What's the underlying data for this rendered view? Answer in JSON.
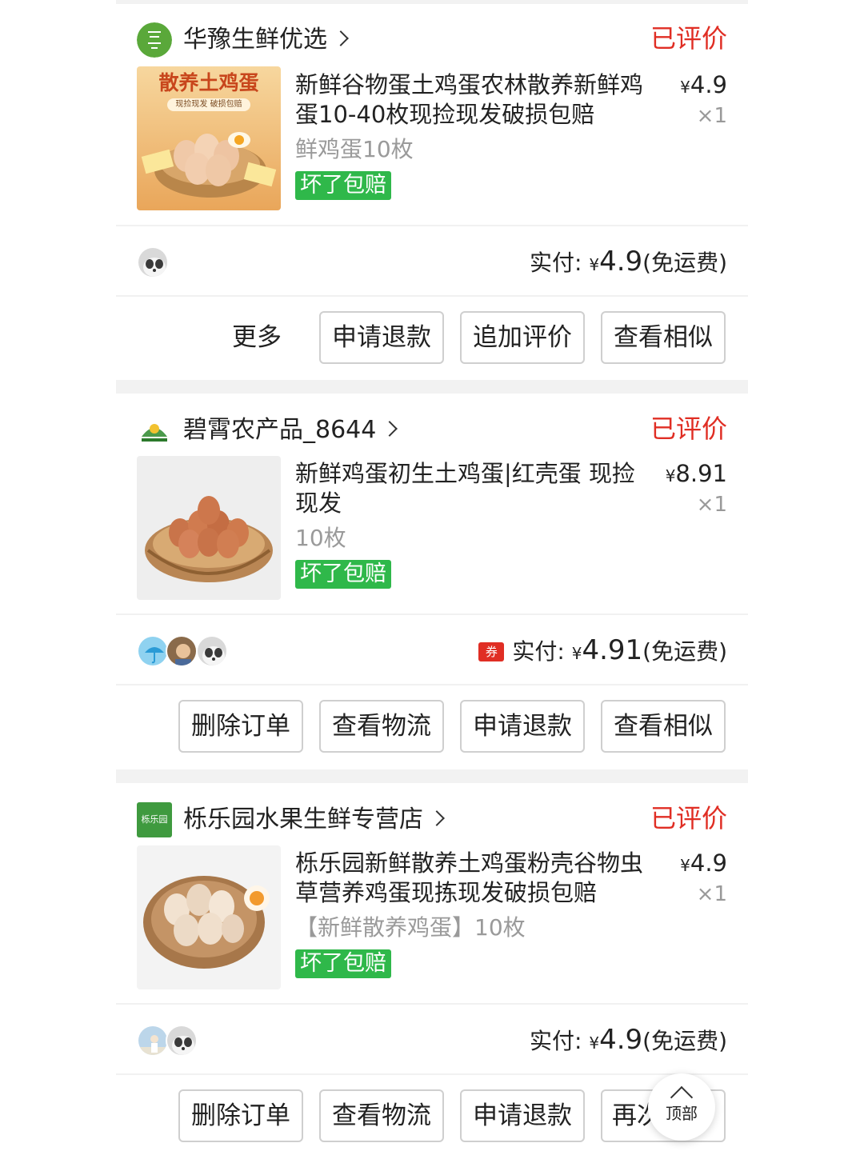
{
  "orders": [
    {
      "shop_name": "华豫生鲜优选",
      "status": "已评价",
      "title": "新鲜谷物蛋土鸡蛋农林散养新鲜鸡蛋10-40枚现捡现发破损包赔",
      "image_text": "散养土鸡蛋",
      "image_subtext": "现捡现发  破损包赔",
      "spec": "鲜鸡蛋10枚",
      "badge": "坏了包赔",
      "price_symbol": "¥",
      "price": "4.9",
      "qty": "×1",
      "pay_label": "实付:",
      "pay_symbol": "¥",
      "pay_amount": "4.9",
      "pay_note": "(免运费)",
      "buttons": [
        "更多",
        "申请退款",
        "追加评价",
        "查看相似"
      ]
    },
    {
      "shop_name": "碧霄农产品_8644",
      "status": "已评价",
      "title": "新鲜鸡蛋初生土鸡蛋|红壳蛋 现捡现发",
      "spec": "10枚",
      "badge": "坏了包赔",
      "price_symbol": "¥",
      "price": "8.91",
      "qty": "×1",
      "coupon": "券",
      "pay_label": "实付:",
      "pay_symbol": "¥",
      "pay_amount": "4.91",
      "pay_note": "(免运费)",
      "buttons": [
        "删除订单",
        "查看物流",
        "申请退款",
        "查看相似"
      ]
    },
    {
      "shop_name": "栎乐园水果生鲜专营店",
      "shop_logo_text": "栎乐园",
      "status": "已评价",
      "title": "栎乐园新鲜散养土鸡蛋粉壳谷物虫草营养鸡蛋现拣现发破损包赔",
      "spec": "【新鲜散养鸡蛋】10枚",
      "badge": "坏了包赔",
      "price_symbol": "¥",
      "price": "4.9",
      "qty": "×1",
      "pay_label": "实付:",
      "pay_symbol": "¥",
      "pay_amount": "4.9",
      "pay_note": "(免运费)",
      "buttons": [
        "删除订单",
        "查看物流",
        "申请退款",
        "再次购买"
      ]
    }
  ],
  "back_to_top": "顶部",
  "colors": {
    "accent_red": "#e02e24",
    "badge_green": "#2fb84a",
    "separator": "#f2f2f2"
  }
}
